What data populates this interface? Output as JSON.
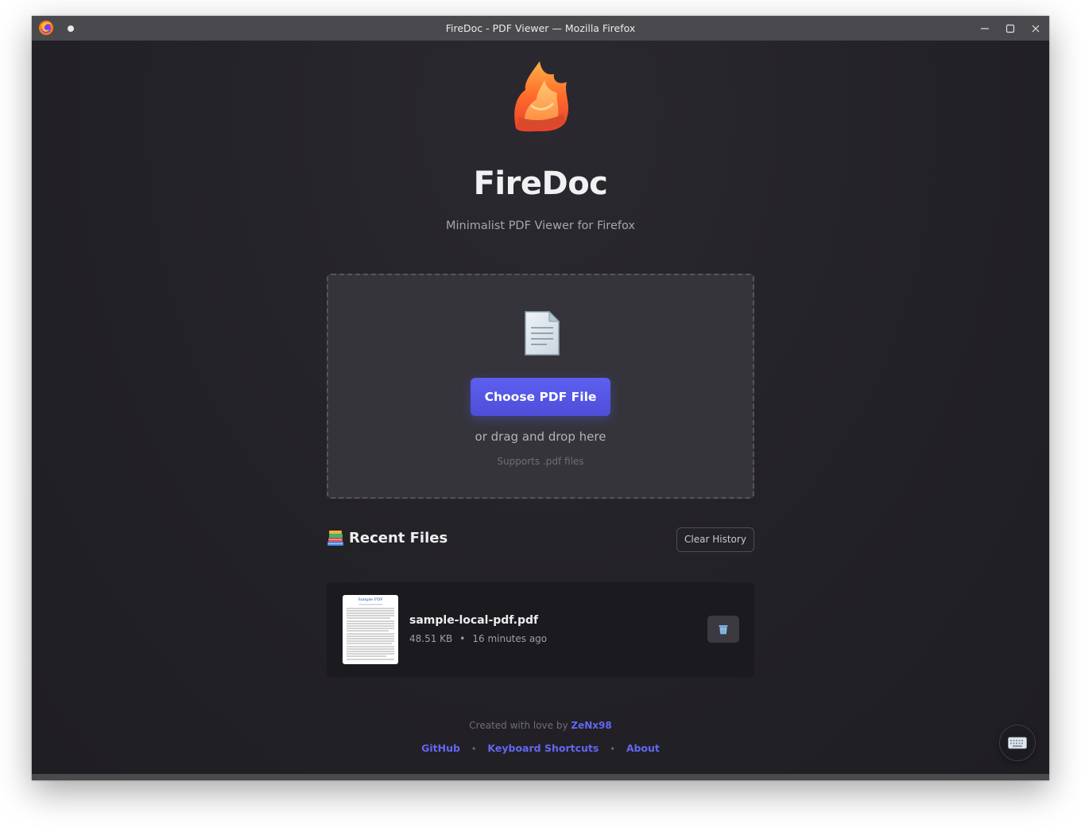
{
  "window": {
    "title": "FireDoc - PDF Viewer — Mozilla Firefox"
  },
  "app": {
    "name": "FireDoc",
    "tagline": "Minimalist PDF Viewer for Firefox",
    "logo_icon": "flame-document-icon"
  },
  "dropzone": {
    "icon": "document-icon",
    "button_label": "Choose PDF File",
    "drag_text": "or drag and drop here",
    "supports_text": "Supports .pdf files"
  },
  "recent": {
    "icon": "books-icon",
    "title": "Recent Files",
    "clear_label": "Clear History",
    "files": [
      {
        "name": "sample-local-pdf.pdf",
        "size": "48.51 KB",
        "separator": "•",
        "time": "16 minutes ago",
        "thumbnail_title": "Sample PDF",
        "delete_icon": "trash-icon"
      }
    ]
  },
  "footer": {
    "credit_prefix": "Created with love by ",
    "author": "ZeNx98",
    "links": [
      "GitHub",
      "Keyboard Shortcuts",
      "About"
    ],
    "separator": "•"
  },
  "floating": {
    "keyboard_icon": "keyboard-icon"
  },
  "colors": {
    "accent": "#6366f1",
    "background": "#232227",
    "dropzone": "#35343b",
    "card": "#1b1a1f"
  }
}
